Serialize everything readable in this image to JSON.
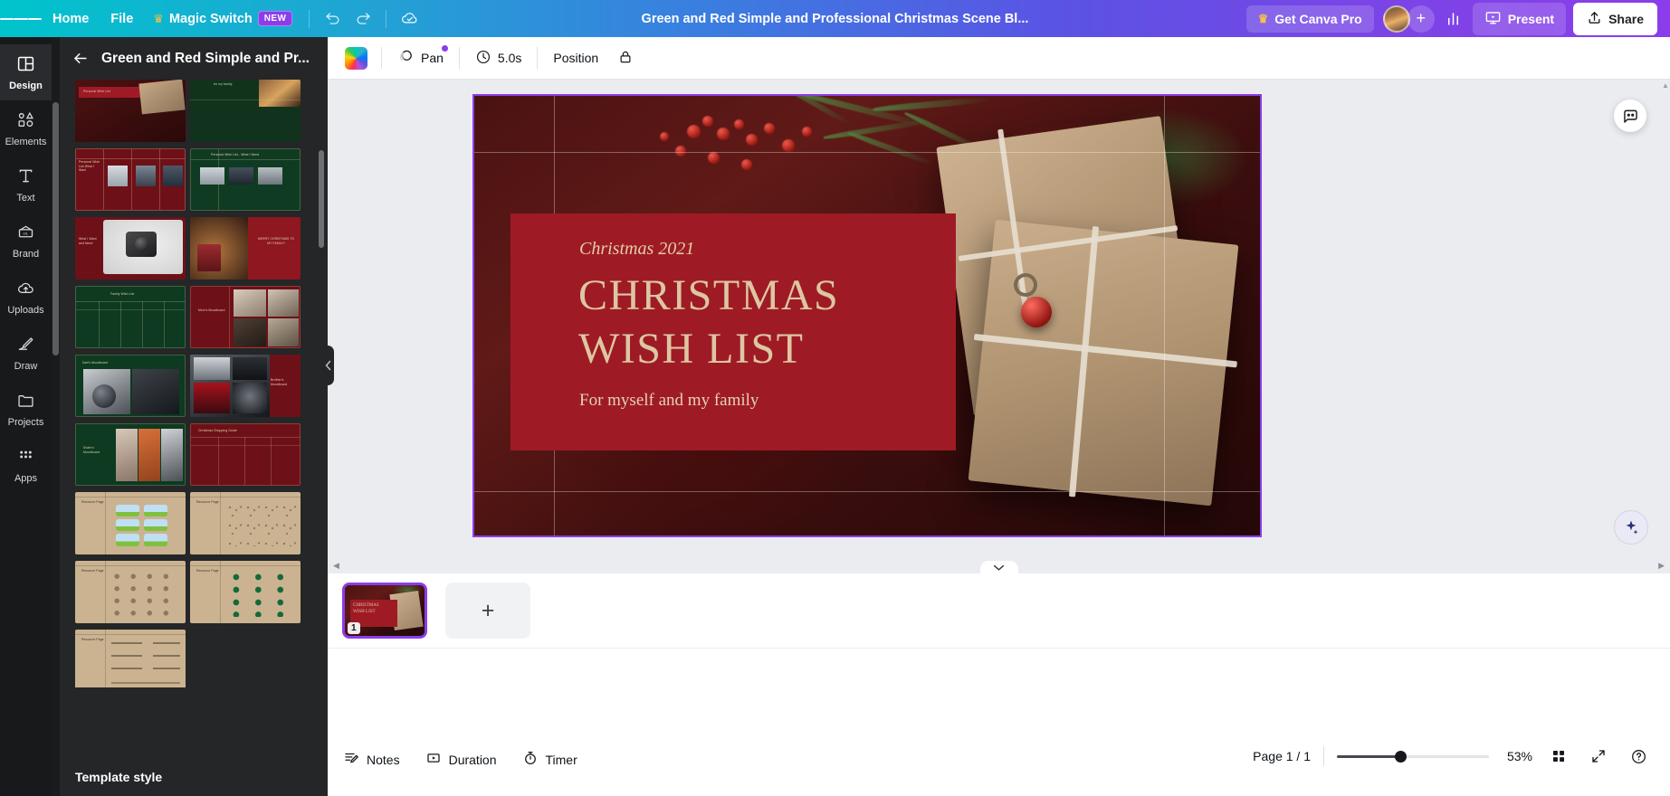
{
  "topbar": {
    "menu_icon": "hamburger-icon",
    "items": [
      {
        "label": "Home",
        "name": "home"
      },
      {
        "label": "File",
        "name": "file"
      }
    ],
    "magic_switch": {
      "label": "Magic Switch",
      "badge": "NEW",
      "icon": "crown-icon"
    },
    "undo_icon": "undo-icon",
    "redo_icon": "redo-icon",
    "cloud_icon": "cloud-saved-icon",
    "doc_title": "Green and Red Simple and Professional Christmas Scene Bl...",
    "get_pro": {
      "label": "Get Canva Pro",
      "icon": "crown-icon"
    },
    "avatar": "user-avatar",
    "add_member": "+",
    "insights_icon": "insights-bar-chart-icon",
    "present": {
      "label": "Present",
      "icon": "present-screen-icon"
    },
    "share": {
      "label": "Share",
      "icon": "share-upload-icon"
    }
  },
  "rail": {
    "items": [
      {
        "label": "Design",
        "icon": "design-layout-icon",
        "active": true
      },
      {
        "label": "Elements",
        "icon": "elements-shapes-icon",
        "active": false
      },
      {
        "label": "Text",
        "icon": "text-t-icon",
        "active": false
      },
      {
        "label": "Brand",
        "icon": "brand-kit-icon",
        "active": false
      },
      {
        "label": "Uploads",
        "icon": "upload-cloud-icon",
        "active": false
      },
      {
        "label": "Draw",
        "icon": "draw-pen-icon",
        "active": false
      },
      {
        "label": "Projects",
        "icon": "projects-folder-icon",
        "active": false
      },
      {
        "label": "Apps",
        "icon": "apps-grid-icon",
        "active": false
      }
    ]
  },
  "panel": {
    "back_icon": "back-arrow-icon",
    "title": "Green and Red Simple and Pr...",
    "footer_label": "Template style",
    "thumbnails": [
      {
        "name": "thumb-personal-list-red",
        "style": "red-photo",
        "title": "Personal Wish List"
      },
      {
        "name": "thumb-green-family",
        "style": "green-photo",
        "title": "for my family"
      },
      {
        "name": "thumb-personal-wish-red",
        "style": "red-table",
        "title": "Personal Wish List What I Want"
      },
      {
        "name": "thumb-personal-wish-green",
        "style": "green-table",
        "title": "Personal Wish List - What I Need"
      },
      {
        "name": "thumb-what-i-want-need",
        "style": "red-camera",
        "title": "What I Want and Need"
      },
      {
        "name": "thumb-merry-christmas",
        "style": "photo-merry",
        "title": "MERRY CHRISTMAS TO MY FAMILY!"
      },
      {
        "name": "thumb-family-wish-list",
        "style": "green-grid",
        "title": "Family Wish List"
      },
      {
        "name": "thumb-moms-moodboard",
        "style": "red-moodboard",
        "title": "Mom's Moodboard"
      },
      {
        "name": "thumb-dads-moodboard",
        "style": "green-cars",
        "title": "Dad's Moodboard"
      },
      {
        "name": "thumb-brothers-moodboard",
        "style": "red-tech",
        "title": "Brother's Moodboard"
      },
      {
        "name": "thumb-sisters-moodboard",
        "style": "green-fitness",
        "title": "Sister's Moodboard"
      },
      {
        "name": "thumb-shopping-guide",
        "style": "red-guide",
        "title": "Christmas Shopping Guide"
      },
      {
        "name": "thumb-resource-page-1",
        "style": "beige-cards",
        "title": "Resource Page"
      },
      {
        "name": "thumb-resource-page-2",
        "style": "beige-line",
        "title": "Resource Page"
      },
      {
        "name": "thumb-resource-page-3",
        "style": "beige-icons",
        "title": "Resource Page"
      },
      {
        "name": "thumb-resource-page-4",
        "style": "beige-green",
        "title": "Resource Page"
      },
      {
        "name": "thumb-resource-page-5",
        "style": "beige-text",
        "title": "Resource Page"
      }
    ]
  },
  "context_toolbar": {
    "color_chip": "rainbow-color-swatch",
    "animate": {
      "label": "Pan",
      "icon": "animate-pan-icon",
      "has_dot": true
    },
    "duration": {
      "label": "5.0s",
      "icon": "clock-icon"
    },
    "position": {
      "label": "Position"
    },
    "lock": {
      "icon": "lock-icon"
    }
  },
  "canvas": {
    "ai_assistant_icon": "magic-ai-icon",
    "canva_assistant_icon": "canva-assistant-sparkle-icon",
    "design": {
      "eyebrow": "Christmas 2021",
      "title_line1": "CHRISTMAS",
      "title_line2": "WISH LIST",
      "subtitle": "For myself and my family"
    }
  },
  "page_strip": {
    "page_number": "1",
    "add_page_label": "+"
  },
  "bottombar": {
    "notes": {
      "label": "Notes",
      "icon": "notes-icon"
    },
    "duration": {
      "label": "Duration",
      "icon": "duration-play-icon"
    },
    "timer": {
      "label": "Timer",
      "icon": "timer-stopwatch-icon"
    },
    "page_count": "Page 1 / 1",
    "zoom_value": "53%",
    "grid_view_icon": "grid-view-icon",
    "fullscreen_icon": "fullscreen-expand-icon",
    "help_icon": "help-question-icon"
  },
  "colors": {
    "brand_teal": "#00c4cc",
    "brand_purple": "#8b3dea",
    "selection": "#8b3dea",
    "design_red": "#9e1b25",
    "design_gold": "#ddc6a2",
    "panel_dark": "#252627",
    "rail_dark": "#18191b"
  }
}
